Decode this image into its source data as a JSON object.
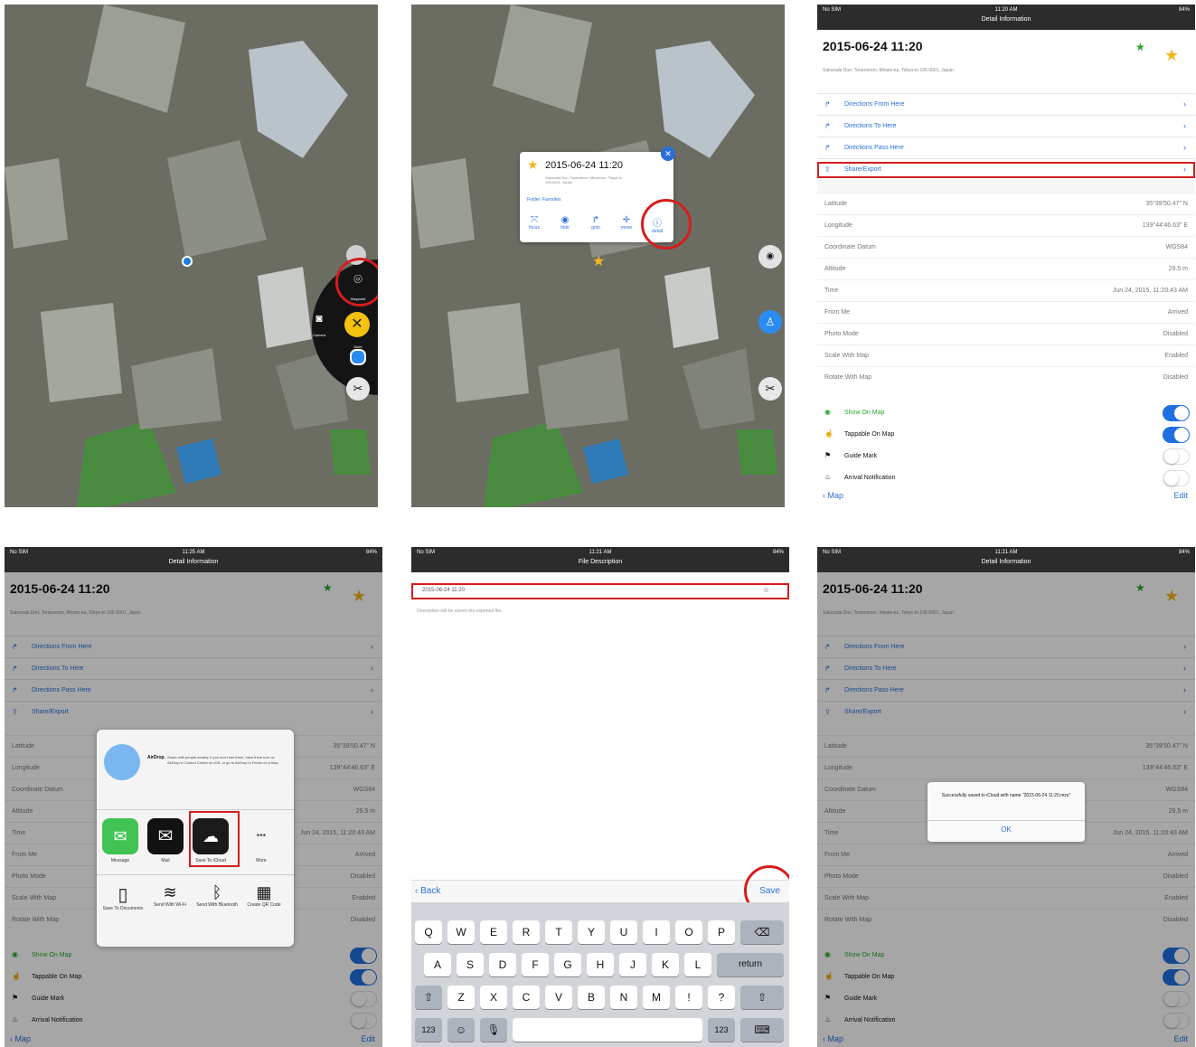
{
  "panel1": {
    "menu": {
      "waypoint_label": "Waypoint",
      "camera_label": "Camera",
      "more_label": "More"
    }
  },
  "panel2": {
    "popup": {
      "title": "2015-06-24 11:20",
      "address": "Sakurada Dori, Toranomon, Minato-ku, Tokyo-to 105-0001, Japan",
      "folder": "Folder: Favorites",
      "actions": [
        "focus",
        "hide",
        "goto",
        "move",
        "detail"
      ]
    }
  },
  "detail": {
    "status_carrier": "No SIM",
    "status_time": "11:20 AM",
    "status_battery": "84%",
    "nav_title": "Detail Information",
    "title": "2015-06-24 11:20",
    "address": "Sakurada Dori, Toranomon, Minato-ku, Tokyo-to 105-0001, Japan",
    "actions": [
      {
        "label": "Directions From Here"
      },
      {
        "label": "Directions To Here"
      },
      {
        "label": "Directions Pass Here"
      },
      {
        "label": "Share/Export"
      }
    ],
    "properties": [
      {
        "label": "Latitude",
        "value": "35°39'50.47\" N"
      },
      {
        "label": "Longitude",
        "value": "139°44'46.63\" E"
      },
      {
        "label": "Coordinate Datum",
        "value": "WGS84"
      },
      {
        "label": "Altitude",
        "value": "29.5 m"
      },
      {
        "label": "Time",
        "value": "Jun 24, 2015, 11:20:43 AM"
      },
      {
        "label": "From Me",
        "value": "Arrived"
      },
      {
        "label": "Photo Mode",
        "value": "Disabled"
      },
      {
        "label": "Scale With Map",
        "value": "Enabled"
      },
      {
        "label": "Rotate With Map",
        "value": "Disabled"
      }
    ],
    "toggles": [
      {
        "label": "Show On Map"
      },
      {
        "label": "Tappable On Map"
      },
      {
        "label": "Guide Mark"
      },
      {
        "label": "Arrival Notification"
      }
    ],
    "back_label": "Map",
    "edit_label": "Edit"
  },
  "panel4": {
    "status_time": "11:25 AM",
    "airdrop_title": "AirDrop.",
    "airdrop_text": "Share with people nearby. If you don't see them, have them turn on AirDrop in Control Center on iOS, or go to AirDrop in Finder on a Mac.",
    "apps": [
      "Message",
      "Mail",
      "Save To iCloud",
      "More"
    ],
    "more_glyph": "•••",
    "actions": [
      "Save To Documents",
      "Send With Wi-Fi",
      "Send With Bluetooth",
      "Create QR Code"
    ]
  },
  "panel5": {
    "status_time": "11:21 AM",
    "nav_title": "File Description",
    "filename": "2015-06-24 11:20",
    "hint": "Description will be saved into exported file.",
    "back_label": "Back",
    "save_label": "Save",
    "keys_row1": [
      "Q",
      "W",
      "E",
      "R",
      "T",
      "Y",
      "U",
      "I",
      "O",
      "P"
    ],
    "keys_row2": [
      "A",
      "S",
      "D",
      "F",
      "G",
      "H",
      "J",
      "K",
      "L"
    ],
    "return_label": "return",
    "keys_row3": [
      "Z",
      "X",
      "C",
      "V",
      "B",
      "N",
      "M",
      "!",
      "?"
    ],
    "num_label": "123"
  },
  "panel6": {
    "status_time": "11:21 AM",
    "alert_text": "Successfully saved to iCloud with name \"2015-06-24 11:20.mzo\"",
    "ok_label": "OK"
  }
}
